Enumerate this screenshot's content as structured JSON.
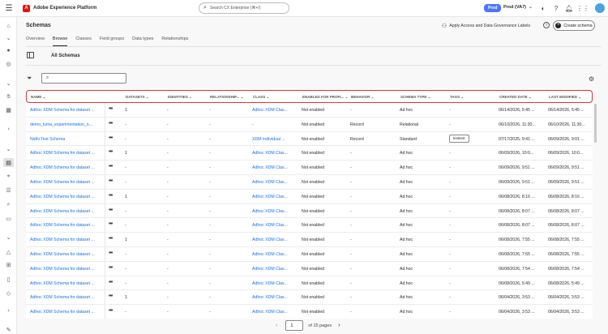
{
  "app": {
    "logo": "A",
    "title": "Adobe Experience Platform"
  },
  "topbar": {
    "search_placeholder": "Search CX Enterprise (⌘+/)",
    "env_badge": "Prod",
    "org": "Prod (VA7)",
    "icons": [
      "notifications-icon",
      "help-icon",
      "bell-icon",
      "apps-grid-icon"
    ]
  },
  "page": {
    "title": "Schemas",
    "tabs": [
      "Overview",
      "Browse",
      "Classes",
      "Field groups",
      "Data types",
      "Relationships"
    ],
    "active_tab": "Browse",
    "apply_labels": "Apply Access and Data Governance Labels",
    "create_schema": "Create schema",
    "section_title": "All Schemas"
  },
  "table": {
    "headers": [
      "NAME",
      "DATASETS",
      "IDENTITIES",
      "RELATIONSHIP...",
      "CLASS",
      "ENABLED FOR PROFI...",
      "BEHAVIOR",
      "SCHEMA TYPE",
      "TAGS",
      "CREATED DATE",
      "LAST MODIFIED"
    ],
    "rows": [
      [
        "Adhoc XDM Schema for dataset ...",
        "1",
        "-",
        "-",
        "Adhoc XDM Clas...",
        "Not enabled",
        "-",
        "Ad hoc",
        "-",
        "06/14/2026, 5:45 ...",
        "06/14/2026, 5:45 ..."
      ],
      [
        "demo_luma_experimentation_o...",
        "-",
        "-",
        "-",
        "-",
        "Not enabled",
        "Record",
        "Relational",
        "-",
        "06/10/2026, 11:30...",
        "06/10/2026, 11:30..."
      ],
      [
        "Nidhi Test Schema",
        "-",
        "-",
        "-",
        "XDM Individual ...",
        "Not enabled",
        "Record",
        "Standard",
        "testtest",
        "07/17/2025, 9:41 ...",
        "06/09/2026, 9:01 ..."
      ],
      [
        "Adhoc XDM Schema for dataset ...",
        "1",
        "-",
        "-",
        "Adhoc XDM Clas...",
        "Not enabled",
        "-",
        "Ad hoc",
        "-",
        "06/09/2026, 10:0...",
        "06/09/2026, 10:0..."
      ],
      [
        "Adhoc XDM Schema for dataset ...",
        "-",
        "-",
        "-",
        "Adhoc XDM Clas...",
        "Not enabled",
        "-",
        "Ad hoc",
        "-",
        "06/09/2026, 9:51 ...",
        "06/09/2026, 9:51 ..."
      ],
      [
        "Adhoc XDM Schema for dataset ...",
        "-",
        "-",
        "-",
        "Adhoc XDM Clas...",
        "Not enabled",
        "-",
        "Ad hoc",
        "-",
        "06/09/2026, 9:51 ...",
        "06/09/2026, 9:51 ..."
      ],
      [
        "Adhoc XDM Schema for dataset ...",
        "1",
        "-",
        "-",
        "Adhoc XDM Clas...",
        "Not enabled",
        "-",
        "Ad hoc",
        "-",
        "06/08/2026, 8:16 ...",
        "06/08/2026, 8:16 ..."
      ],
      [
        "Adhoc XDM Schema for dataset ...",
        "-",
        "-",
        "-",
        "Adhoc XDM Clas...",
        "Not enabled",
        "-",
        "Ad hoc",
        "-",
        "06/08/2026, 8:07 ...",
        "06/08/2026, 8:07 ..."
      ],
      [
        "Adhoc XDM Schema for dataset ...",
        "-",
        "-",
        "-",
        "Adhoc XDM Clas...",
        "Not enabled",
        "-",
        "Ad hoc",
        "-",
        "06/08/2026, 8:07 ...",
        "06/08/2026, 8:07 ..."
      ],
      [
        "Adhoc XDM Schema for dataset ...",
        "1",
        "-",
        "-",
        "Adhoc XDM Clas...",
        "Not enabled",
        "-",
        "Ad hoc",
        "-",
        "06/08/2026, 7:55 ...",
        "06/08/2026, 7:55 ..."
      ],
      [
        "Adhoc XDM Schema for dataset ...",
        "-",
        "-",
        "-",
        "Adhoc XDM Clas...",
        "Not enabled",
        "-",
        "Ad hoc",
        "-",
        "06/08/2026, 7:55 ...",
        "06/08/2026, 7:55 ..."
      ],
      [
        "Adhoc XDM Schema for dataset ...",
        "-",
        "-",
        "-",
        "Adhoc XDM Clas...",
        "Not enabled",
        "-",
        "Ad hoc",
        "-",
        "06/08/2026, 7:54 ...",
        "06/08/2026, 7:54 ..."
      ],
      [
        "Adhoc XDM Schema for dataset ...",
        "-",
        "-",
        "-",
        "Adhoc XDM Clas...",
        "Not enabled",
        "-",
        "Ad hoc",
        "-",
        "06/08/2026, 5:49 ...",
        "06/08/2026, 5:49 ..."
      ],
      [
        "Adhoc XDM Schema for dataset ...",
        "1",
        "-",
        "-",
        "Adhoc XDM Clas...",
        "Not enabled",
        "-",
        "Ad hoc",
        "-",
        "06/04/2026, 3:53 ...",
        "06/04/2026, 3:53 ..."
      ],
      [
        "Adhoc XDM Schema for dataset ...",
        "-",
        "-",
        "-",
        "Adhoc XDM Clas...",
        "Not enabled",
        "-",
        "Ad hoc",
        "-",
        "06/04/2026, 3:53 ...",
        "06/04/2026, 3:53 ..."
      ]
    ]
  },
  "pagination": {
    "current_page": "1",
    "total_label": "of 15 pages"
  },
  "colors": {
    "accent": "#1473e6",
    "highlight": "#d7373f",
    "prod": "#4b75ff"
  }
}
